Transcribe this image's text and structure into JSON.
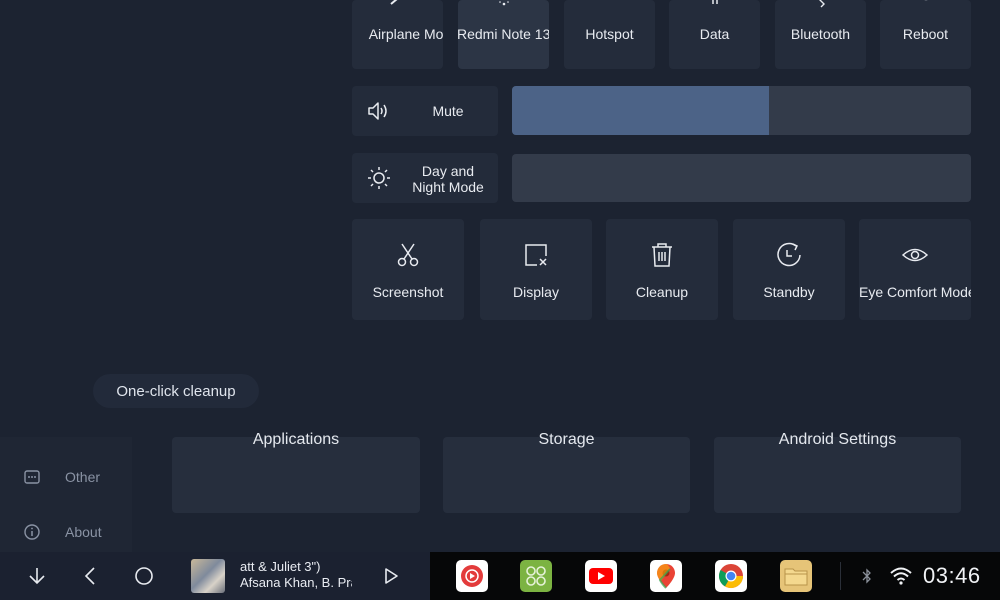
{
  "quick_toggles": [
    {
      "label": "Airplane Mode",
      "icon": "airplane-icon",
      "active": false
    },
    {
      "label": "Redmi Note 13",
      "icon": "wifi-icon",
      "active": true
    },
    {
      "label": "Hotspot",
      "icon": "hotspot-icon",
      "active": false
    },
    {
      "label": "Data",
      "icon": "mobile-data-icon",
      "active": false
    },
    {
      "label": "Bluetooth",
      "icon": "bluetooth-icon",
      "active": false
    },
    {
      "label": "Reboot",
      "icon": "power-icon",
      "active": false
    }
  ],
  "volume": {
    "label": "Mute",
    "icon": "speaker-icon",
    "level": 0.56
  },
  "brightness": {
    "label_line1": "Day and",
    "label_line2": "Night Mode",
    "icon": "sun-icon",
    "level": 0
  },
  "shortcuts": [
    {
      "label": "Screenshot",
      "icon": "scissors-icon"
    },
    {
      "label": "Display",
      "icon": "display-icon"
    },
    {
      "label": "Cleanup",
      "icon": "trash-icon"
    },
    {
      "label": "Standby",
      "icon": "standby-icon"
    },
    {
      "label": "Eye Comfort Mode",
      "icon": "eye-icon"
    }
  ],
  "toast": {
    "text": "One-click cleanup"
  },
  "settings_page": {
    "cards": [
      "Applications",
      "Storage",
      "Android Settings"
    ],
    "sidebar": [
      {
        "label": "Other",
        "icon": "other-icon"
      },
      {
        "label": "About",
        "icon": "info-icon"
      }
    ]
  },
  "taskbar": {
    "nav": [
      "down-icon",
      "back-icon",
      "home-icon"
    ],
    "media": {
      "title": "att & Juliet 3\")",
      "artist": "Afsana Khan, B. Praak"
    },
    "apps": [
      {
        "name": "youtube-music-icon",
        "color": "#e33b3b"
      },
      {
        "name": "app-grid-icon",
        "color": "#7cb342"
      },
      {
        "name": "youtube-icon",
        "color": "#ff0000"
      },
      {
        "name": "maps-icon",
        "color": "#4285f4"
      },
      {
        "name": "chrome-icon",
        "color": "#fbbc05"
      },
      {
        "name": "files-icon",
        "color": "#e6c478"
      }
    ],
    "time": "03:46"
  }
}
